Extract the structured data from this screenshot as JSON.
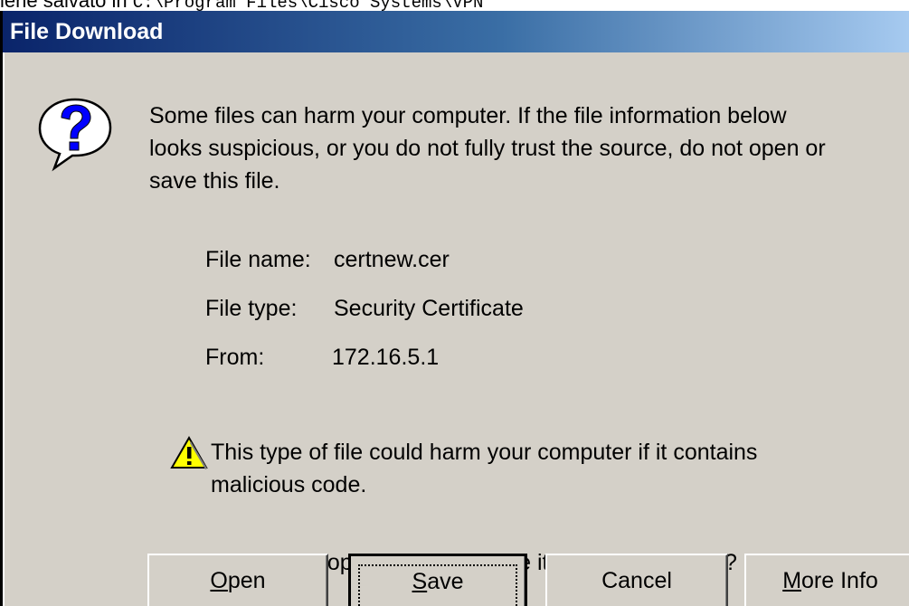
{
  "caption": {
    "text": "iene salvato in ",
    "path": "C:\\Program Files\\Cisco Systems\\VPN"
  },
  "dialog": {
    "title": "File Download",
    "intro_lines": [
      "Some files can harm your computer. If the file information below",
      "looks suspicious, or you do not fully trust the source, do not open or",
      "save this file."
    ],
    "file_name_label": "File name:",
    "file_name_value": "certnew.cer",
    "file_type_label": "File type:",
    "file_type_value": "Security Certificate",
    "from_label": "From:",
    "from_value": "172.16.5.1",
    "warning_lines": [
      "This type of file could harm your computer if it contains",
      "malicious code."
    ],
    "question": "Would you like to open the file or save it to your computer?"
  },
  "buttons": {
    "open": {
      "accel": "O",
      "rest": "pen"
    },
    "save": {
      "accel": "S",
      "rest": "ave"
    },
    "cancel": {
      "label": "Cancel"
    },
    "more_info": {
      "accel": "M",
      "rest": "ore Info"
    }
  },
  "icons": {
    "question": "question-icon",
    "warning": "warning-icon"
  },
  "colors": {
    "titlebar_start": "#0a246a",
    "titlebar_end": "#a6caf0",
    "dialog_face": "#d4d0c8",
    "question_mark": "#0000ff",
    "warning_yellow": "#ffff00"
  }
}
